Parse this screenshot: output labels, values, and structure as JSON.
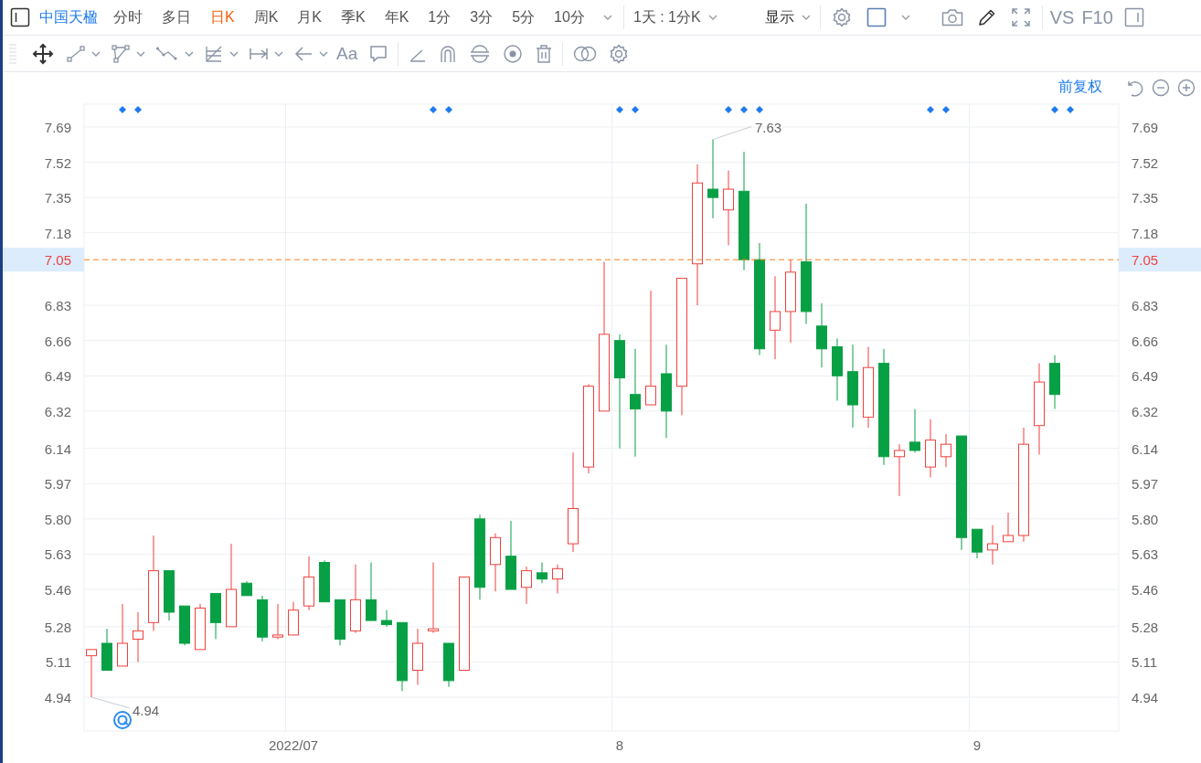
{
  "toolbar": {
    "stock_name": "中国天楹",
    "periods": [
      {
        "label": "分时",
        "selected": false
      },
      {
        "label": "多日",
        "selected": false
      },
      {
        "label": "日K",
        "selected": true
      },
      {
        "label": "周K",
        "selected": false
      },
      {
        "label": "月K",
        "selected": false
      },
      {
        "label": "季K",
        "selected": false
      },
      {
        "label": "年K",
        "selected": false
      },
      {
        "label": "1分",
        "selected": false
      },
      {
        "label": "3分",
        "selected": false
      },
      {
        "label": "5分",
        "selected": false
      },
      {
        "label": "10分",
        "selected": false
      }
    ],
    "range": "1天 : 1分K",
    "display": "显示",
    "vs": "VS",
    "f10": "F10"
  },
  "drawing_toolbar": {
    "text_tool": "Aa"
  },
  "chart": {
    "adjust": "前复权",
    "events": [
      {
        "marked": false
      },
      {
        "marked": false
      },
      {
        "marked": true
      },
      {
        "marked": true
      },
      {
        "marked": false
      },
      {
        "marked": false
      },
      {
        "marked": false
      },
      {
        "marked": false
      },
      {
        "marked": false
      },
      {
        "marked": false
      },
      {
        "marked": false
      },
      {
        "marked": false
      },
      {
        "marked": false
      },
      {
        "marked": false
      },
      {
        "marked": false
      },
      {
        "marked": false
      },
      {
        "marked": false
      },
      {
        "marked": false
      },
      {
        "marked": false
      },
      {
        "marked": false
      },
      {
        "marked": false
      },
      {
        "marked": false
      },
      {
        "marked": true
      },
      {
        "marked": true
      },
      {
        "marked": false
      },
      {
        "marked": false
      },
      {
        "marked": false
      },
      {
        "marked": false
      },
      {
        "marked": false
      },
      {
        "marked": false
      },
      {
        "marked": false
      },
      {
        "marked": false
      },
      {
        "marked": false
      },
      {
        "marked": false
      },
      {
        "marked": true
      },
      {
        "marked": true
      },
      {
        "marked": false
      },
      {
        "marked": false
      },
      {
        "marked": false
      },
      {
        "marked": false
      },
      {
        "marked": false
      },
      {
        "marked": true
      },
      {
        "marked": true
      },
      {
        "marked": true
      },
      {
        "marked": false
      },
      {
        "marked": false
      },
      {
        "marked": false
      },
      {
        "marked": false
      },
      {
        "marked": false
      },
      {
        "marked": false
      },
      {
        "marked": false
      },
      {
        "marked": false
      },
      {
        "marked": false
      },
      {
        "marked": false
      },
      {
        "marked": true
      },
      {
        "marked": true
      },
      {
        "marked": false
      },
      {
        "marked": false
      },
      {
        "marked": false
      },
      {
        "marked": false
      },
      {
        "marked": false
      },
      {
        "marked": false
      },
      {
        "marked": true
      },
      {
        "marked": true
      }
    ],
    "chart_data": {
      "type": "candlestick",
      "grid": true,
      "categories": [
        null,
        null,
        null,
        null,
        null,
        null,
        null,
        null,
        null,
        null,
        null,
        null,
        null,
        "2022/07",
        null,
        null,
        null,
        null,
        null,
        null,
        null,
        null,
        null,
        null,
        null,
        null,
        null,
        null,
        null,
        null,
        null,
        null,
        null,
        null,
        "8",
        null,
        null,
        null,
        null,
        null,
        null,
        null,
        null,
        null,
        null,
        null,
        null,
        null,
        null,
        null,
        null,
        null,
        null,
        null,
        null,
        null,
        null,
        "9",
        null,
        null,
        null,
        null,
        null
      ],
      "ylim": [
        4.777,
        7.8
      ],
      "yticks": [
        {
          "value": 7.69,
          "label": "7.69"
        },
        {
          "value": 7.52,
          "label": "7.52"
        },
        {
          "value": 7.35,
          "label": "7.35"
        },
        {
          "value": 7.18,
          "label": "7.18"
        },
        {
          "value": 6.83,
          "label": "6.83"
        },
        {
          "value": 6.66,
          "label": "6.66"
        },
        {
          "value": 6.49,
          "label": "6.49"
        },
        {
          "value": 6.32,
          "label": "6.32"
        },
        {
          "value": 6.14,
          "label": "6.14"
        },
        {
          "value": 5.97,
          "label": "5.97"
        },
        {
          "value": 5.8,
          "label": "5.80"
        },
        {
          "value": 5.63,
          "label": "5.63"
        },
        {
          "value": 5.46,
          "label": "5.46"
        },
        {
          "value": 5.28,
          "label": "5.28"
        },
        {
          "value": 5.11,
          "label": "5.11"
        },
        {
          "value": 4.94,
          "label": "4.94"
        }
      ],
      "ohlc": [
        [
          5.14,
          5.17,
          4.94,
          5.17
        ],
        [
          5.2,
          5.27,
          5.07,
          5.07
        ],
        [
          5.09,
          5.39,
          5.09,
          5.2
        ],
        [
          5.22,
          5.35,
          5.11,
          5.26
        ],
        [
          5.3,
          5.72,
          5.26,
          5.55
        ],
        [
          5.55,
          5.55,
          5.31,
          5.35
        ],
        [
          5.38,
          5.38,
          5.19,
          5.2
        ],
        [
          5.17,
          5.39,
          5.17,
          5.37
        ],
        [
          5.44,
          5.44,
          5.22,
          5.3
        ],
        [
          5.28,
          5.68,
          5.28,
          5.46
        ],
        [
          5.49,
          5.5,
          5.43,
          5.43
        ],
        [
          5.41,
          5.43,
          5.21,
          5.23
        ],
        [
          5.23,
          5.39,
          5.22,
          5.24
        ],
        [
          5.24,
          5.4,
          5.24,
          5.36
        ],
        [
          5.38,
          5.62,
          5.36,
          5.52
        ],
        [
          5.59,
          5.6,
          5.4,
          5.4
        ],
        [
          5.41,
          5.41,
          5.19,
          5.22
        ],
        [
          5.26,
          5.58,
          5.25,
          5.41
        ],
        [
          5.41,
          5.59,
          5.31,
          5.31
        ],
        [
          5.31,
          5.36,
          5.28,
          5.29
        ],
        [
          5.3,
          5.3,
          4.97,
          5.02
        ],
        [
          5.07,
          5.27,
          5.0,
          5.2
        ],
        [
          5.26,
          5.59,
          5.25,
          5.27
        ],
        [
          5.2,
          5.2,
          4.99,
          5.02
        ],
        [
          5.07,
          5.52,
          5.07,
          5.52
        ],
        [
          5.8,
          5.82,
          5.41,
          5.47
        ],
        [
          5.58,
          5.73,
          5.45,
          5.71
        ],
        [
          5.62,
          5.79,
          5.46,
          5.46
        ],
        [
          5.47,
          5.57,
          5.39,
          5.55
        ],
        [
          5.54,
          5.59,
          5.49,
          5.51
        ],
        [
          5.51,
          5.58,
          5.44,
          5.56
        ],
        [
          5.68,
          6.12,
          5.64,
          5.85
        ],
        [
          6.05,
          6.45,
          6.02,
          6.44
        ],
        [
          6.32,
          7.04,
          6.32,
          6.69
        ],
        [
          6.66,
          6.69,
          6.14,
          6.48
        ],
        [
          6.4,
          6.62,
          6.1,
          6.33
        ],
        [
          6.35,
          6.9,
          6.35,
          6.44
        ],
        [
          6.5,
          6.64,
          6.19,
          6.32
        ],
        [
          6.44,
          6.96,
          6.3,
          6.96
        ],
        [
          7.03,
          7.51,
          6.83,
          7.42
        ],
        [
          7.39,
          7.63,
          7.25,
          7.35
        ],
        [
          7.29,
          7.48,
          7.12,
          7.39
        ],
        [
          7.38,
          7.57,
          7.0,
          7.05
        ],
        [
          7.05,
          7.13,
          6.59,
          6.62
        ],
        [
          6.71,
          6.97,
          6.57,
          6.8
        ],
        [
          6.8,
          7.05,
          6.65,
          6.99
        ],
        [
          7.04,
          7.32,
          6.74,
          6.8
        ],
        [
          6.73,
          6.84,
          6.53,
          6.62
        ],
        [
          6.63,
          6.67,
          6.37,
          6.49
        ],
        [
          6.51,
          6.64,
          6.24,
          6.35
        ],
        [
          6.29,
          6.63,
          6.24,
          6.53
        ],
        [
          6.55,
          6.62,
          6.06,
          6.1
        ],
        [
          6.1,
          6.16,
          5.91,
          6.13
        ],
        [
          6.17,
          6.33,
          6.12,
          6.13
        ],
        [
          6.05,
          6.28,
          6.0,
          6.18
        ],
        [
          6.1,
          6.21,
          6.05,
          6.16
        ],
        [
          6.2,
          6.2,
          5.65,
          5.71
        ],
        [
          5.75,
          5.75,
          5.61,
          5.64
        ],
        [
          5.65,
          5.77,
          5.58,
          5.68
        ],
        [
          5.69,
          5.83,
          5.69,
          5.72
        ],
        [
          5.72,
          6.24,
          5.69,
          6.16
        ],
        [
          6.25,
          6.55,
          6.11,
          6.46
        ],
        [
          6.55,
          6.59,
          6.33,
          6.4
        ]
      ],
      "annotations": [
        "7.63",
        "4.94"
      ],
      "ref_lines": [
        {
          "axis": "y",
          "value": 7.05,
          "label": "7.05"
        }
      ]
    }
  }
}
